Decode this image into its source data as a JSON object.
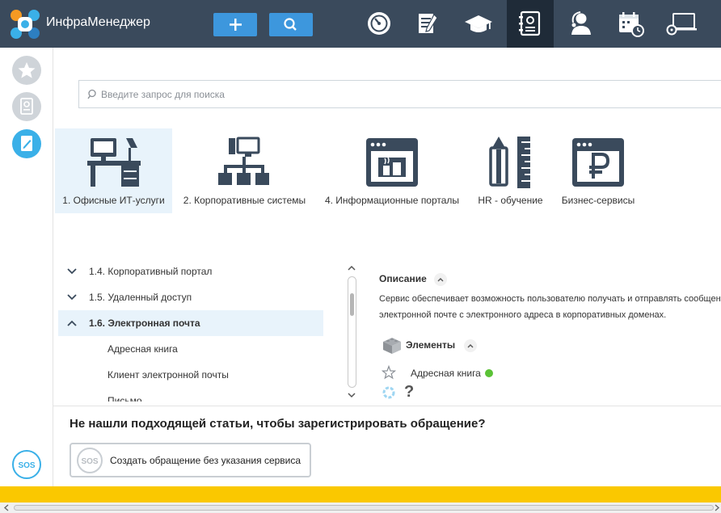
{
  "app": {
    "title": "ИнфраМенеджер"
  },
  "colors": {
    "topbar": "#3a4a5c",
    "accent": "#3d97dd",
    "selected_bg": "#e8f3fb",
    "status_green": "#5bc236",
    "footer_bar": "#fac800"
  },
  "toolbar": {
    "add_icon": "plus-icon",
    "search_icon": "search-icon"
  },
  "nav": {
    "icons": [
      "dashboard-icon",
      "document-edit-icon",
      "graduation-cap-icon",
      "service-catalog-icon",
      "support-agent-icon",
      "calendar-clock-icon",
      "laptop-disc-icon"
    ],
    "active": "service-catalog-icon"
  },
  "rail": {
    "items": [
      "favorites-star-icon",
      "catalog-icon",
      "portal-icon"
    ],
    "active": "portal-icon",
    "sos_label": "SOS"
  },
  "search": {
    "placeholder": "Введите запрос для поиска",
    "value": ""
  },
  "categories": [
    {
      "label": "1. Офисные ИТ-услуги",
      "icon": "office-desk-icon",
      "active": true
    },
    {
      "label": "2. Корпоративные системы",
      "icon": "network-icon",
      "active": false
    },
    {
      "label": "4. Информационные порталы",
      "icon": "portal-window-icon",
      "active": false
    },
    {
      "label": "HR - обучение",
      "icon": "pencil-ruler-icon",
      "active": false
    },
    {
      "label": "Бизнес-сервисы",
      "icon": "ruble-icon",
      "active": false
    }
  ],
  "tree": {
    "items": [
      {
        "label": "1.4. Корпоративный портал",
        "expanded": false,
        "level": 0
      },
      {
        "label": "1.5. Удаленный доступ",
        "expanded": false,
        "level": 0
      },
      {
        "label": "1.6. Электронная почта",
        "expanded": true,
        "level": 0,
        "selected": true
      },
      {
        "label": "Адресная книга",
        "level": 1
      },
      {
        "label": "Клиент электронной почты",
        "level": 1
      },
      {
        "label": "Письмо",
        "level": 1
      }
    ]
  },
  "description": {
    "title": "Описание",
    "lines": [
      "Сервис обеспечивает возможность пользователю получать и отправлять сообщения по",
      "электронной почте с электронного адреса в корпоративных доменах."
    ]
  },
  "elements": {
    "title": "Элементы",
    "items": [
      {
        "label": "Адресная книга",
        "status": "online"
      }
    ],
    "unknown_mark": "?"
  },
  "footer": {
    "question": "Не нашли подходящей статьи, чтобы зарегистрировать обращение?",
    "create_button": "Создать обращение без указания сервиса",
    "sos_label": "SOS"
  }
}
